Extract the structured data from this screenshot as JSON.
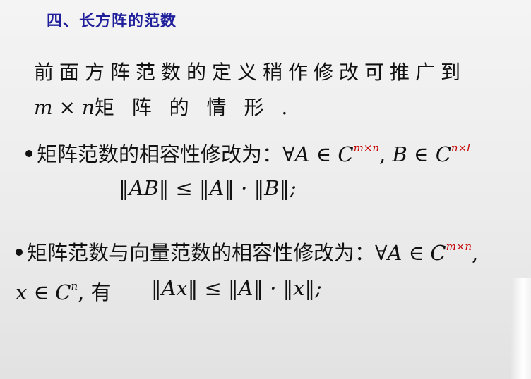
{
  "title": "四、长方阵的范数",
  "intro": {
    "line1": "前面方阵范数的定义稍作修改可推广到",
    "dims": "m × n",
    "line2_tail": "矩 阵 的 情 形 ."
  },
  "bullet1": {
    "text": "矩阵范数的相容性修改为：",
    "forall": "∀",
    "var_a": "A",
    "in1": " ∈ ",
    "set_c": "C",
    "sup1": "m×n",
    "comma": ", ",
    "var_b": "B",
    "in2": " ∈ ",
    "set_c2": "C",
    "sup2": "n×l",
    "formula": "‖AB‖ ≤ ‖A‖ · ‖B‖;"
  },
  "bullet2": {
    "text": "矩阵范数与向量范数的相容性修改为：",
    "forall": "∀",
    "var_a": "A",
    "in1": " ∈ ",
    "set_c": "C",
    "sup1": "m×n",
    "trail": ",",
    "line2_var": "x",
    "line2_in": " ∈ ",
    "line2_set": "C",
    "line2_sup": "n",
    "line2_you": ", 有",
    "formula": "‖Ax‖ ≤ ‖A‖ · ‖x‖;"
  },
  "colors": {
    "title": "#1f1f9c",
    "superscript_accent": "#c40000",
    "text": "#111111"
  }
}
